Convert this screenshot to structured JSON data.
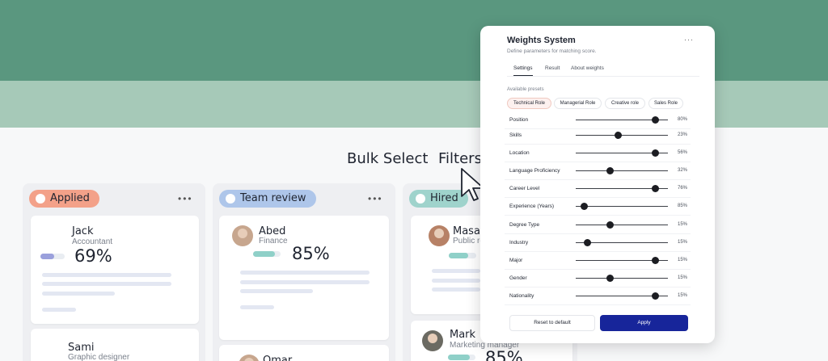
{
  "toolbar": {
    "bulk_select": "Bulk Select",
    "filters": "Filters"
  },
  "columns": [
    {
      "label": "Applied",
      "color": "#f3a189"
    },
    {
      "label": "Team review",
      "color": "#aec6ea"
    },
    {
      "label": "Hired",
      "color": "#9fd3cc"
    }
  ],
  "candidates": [
    {
      "name": "Jack",
      "role": "Accountant",
      "score": "69%",
      "bar_fraction": 0.55,
      "bar_color": "#9aa0dc"
    },
    {
      "name": "Sami",
      "role": "Graphic designer"
    },
    {
      "name": "Abed",
      "role": "Finance",
      "score": "85%",
      "bar_fraction": 0.8,
      "bar_color": "#8fd0c8"
    },
    {
      "name": "Omar"
    },
    {
      "name": "Masa",
      "role": "Public re",
      "bar_fraction": 0.7,
      "bar_color": "#8fd0c8"
    },
    {
      "name": "Mark",
      "role": "Marketing manager",
      "score": "85%",
      "bar_fraction": 0.8,
      "bar_color": "#8fd0c8"
    }
  ],
  "panel": {
    "title": "Weights System",
    "subtitle": "Define parameters for matching score.",
    "menu": "···",
    "tabs": [
      "Settings",
      "Result",
      "About weights"
    ],
    "presets_label": "Available presets",
    "presets": [
      "Technical Role",
      "Managerial Role",
      "Creative role",
      "Sales Role"
    ],
    "weights": [
      {
        "label": "Position",
        "value": 0.86,
        "pct": "80%"
      },
      {
        "label": "Skills",
        "value": 0.46,
        "pct": "23%"
      },
      {
        "label": "Location",
        "value": 0.86,
        "pct": "56%"
      },
      {
        "label": "Language Proficiency",
        "value": 0.37,
        "pct": "32%"
      },
      {
        "label": "Career Level",
        "value": 0.86,
        "pct": "76%"
      },
      {
        "label": "Experience (Years)",
        "value": 0.09,
        "pct": "85%"
      },
      {
        "label": "Degree Type",
        "value": 0.37,
        "pct": "15%"
      },
      {
        "label": "Industry",
        "value": 0.13,
        "pct": "15%"
      },
      {
        "label": "Major",
        "value": 0.86,
        "pct": "15%"
      },
      {
        "label": "Gender",
        "value": 0.37,
        "pct": "15%"
      },
      {
        "label": "Nationality",
        "value": 0.86,
        "pct": "15%"
      }
    ],
    "reset_label": "Reset to default",
    "apply_label": "Apply"
  },
  "icons": {
    "column_menu": "more-horizontal-icon",
    "cursor": "cursor-arrow-icon",
    "pill_dot": "status-dot-icon"
  }
}
